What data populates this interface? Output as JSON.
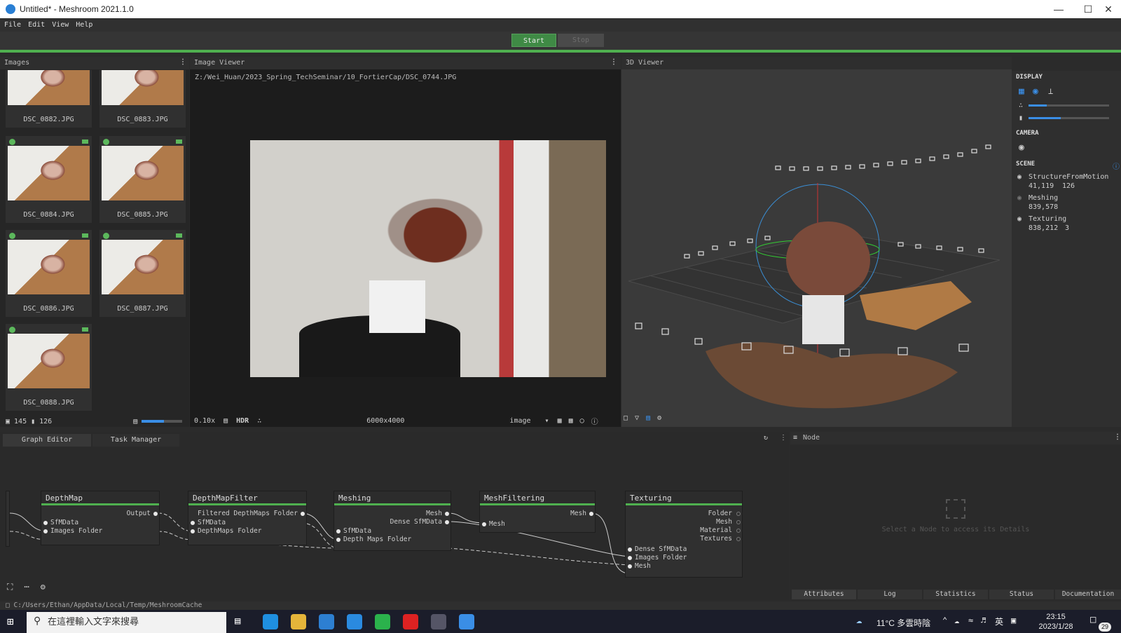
{
  "window": {
    "title": "Untitled* - Meshroom 2021.1.0"
  },
  "menu": [
    "File",
    "Edit",
    "View",
    "Help"
  ],
  "run": {
    "start_label": "Start",
    "stop_label": "Stop"
  },
  "images_panel": {
    "title": "Images",
    "thumbnails": [
      "DSC_0882.JPG",
      "DSC_0883.JPG",
      "DSC_0884.JPG",
      "DSC_0885.JPG",
      "DSC_0886.JPG",
      "DSC_0887.JPG",
      "DSC_0888.JPG"
    ],
    "image_count": "145",
    "camera_count": "126"
  },
  "image_viewer": {
    "title": "Image Viewer",
    "path": "Z:/Wei_Huan/2023_Spring_TechSeminar/10_FortierCap/DSC_0744.JPG",
    "zoom": "0.10x",
    "hdr_label": "HDR",
    "resolution": "6000x4000",
    "channel": "image"
  },
  "viewer3d": {
    "title": "3D Viewer"
  },
  "display_panel": {
    "display_label": "DISPLAY",
    "camera_label": "CAMERA",
    "scene_label": "SCENE",
    "items": [
      {
        "name": "StructureFromMotion",
        "stat1": "41,119",
        "stat2": "126"
      },
      {
        "name": "Meshing",
        "stat1": "839,578",
        "stat2": ""
      },
      {
        "name": "Texturing",
        "stat1": "838,212",
        "stat2": "3"
      }
    ]
  },
  "graph_editor": {
    "tabs": [
      "Graph Editor",
      "Task Manager"
    ],
    "nodes": {
      "depthmap": {
        "title": "DepthMap",
        "out": [
          "Output"
        ],
        "in": [
          "SfMData",
          "Images Folder"
        ]
      },
      "depthmapfilter": {
        "title": "DepthMapFilter",
        "out": [
          "Filtered DepthMaps Folder"
        ],
        "in": [
          "SfMData",
          "DepthMaps Folder"
        ]
      },
      "meshing": {
        "title": "Meshing",
        "out": [
          "Mesh",
          "Dense SfMData"
        ],
        "in": [
          "SfMData",
          "Depth Maps Folder"
        ]
      },
      "meshfiltering": {
        "title": "MeshFiltering",
        "out": [
          "Mesh"
        ],
        "in": [
          "Mesh"
        ]
      },
      "texturing": {
        "title": "Texturing",
        "out": [
          "Folder",
          "Mesh",
          "Material",
          "Textures"
        ],
        "in": [
          "Dense SfMData",
          "Images Folder",
          "Mesh"
        ]
      }
    }
  },
  "node_panel": {
    "title": "Node",
    "placeholder": "Select a Node to access its Details",
    "tabs": [
      "Attributes",
      "Log",
      "Statistics",
      "Status",
      "Documentation"
    ]
  },
  "cache_path": "C:/Users/Ethan/AppData/Local/Temp/MeshroomCache",
  "taskbar": {
    "search_placeholder": "在這裡輸入文字來搜尋",
    "weather": "11°C 多雲時陰",
    "ime": "英",
    "time": "23:15",
    "date": "2023/1/28",
    "notification_count": "29"
  }
}
